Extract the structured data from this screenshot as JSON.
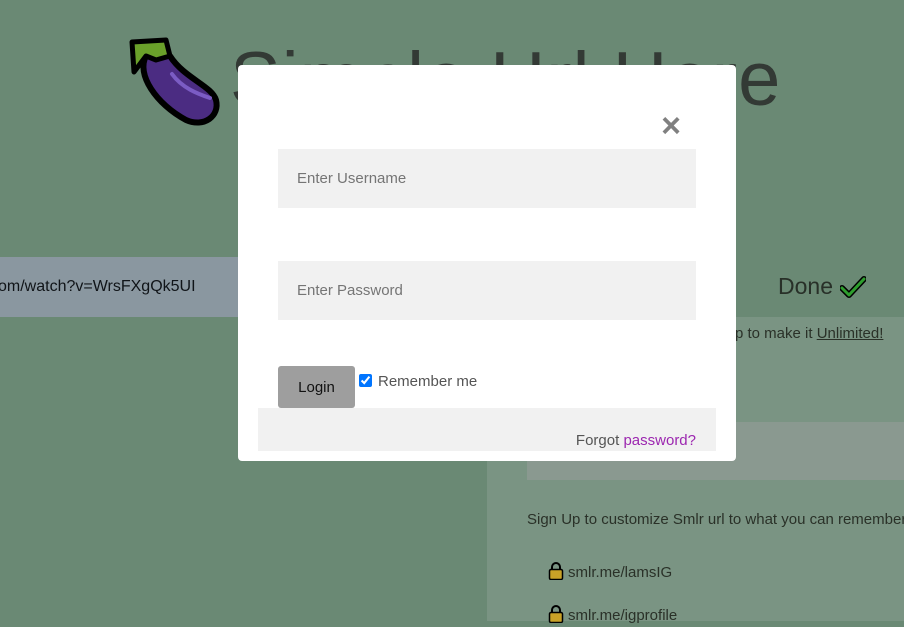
{
  "background": {
    "site_title": "Simple Url Here",
    "url_value": "om/watch?v=WrsFXgQk5UI",
    "done_label": "Done",
    "upgrade_prefix": "p to make it ",
    "upgrade_link": "Unlimited!",
    "signup_text": "Sign Up to customize Smlr url to what you can remember",
    "links": [
      "smlr.me/lamsIG",
      "smlr.me/igprofile"
    ]
  },
  "modal": {
    "close_symbol": "×",
    "username_placeholder": "Enter Username",
    "password_placeholder": "Enter Password",
    "login_label": "Login",
    "remember_label": "Remember me",
    "remember_checked": true,
    "forgot_prefix": "Forgot ",
    "forgot_link": "password?"
  },
  "icons": {
    "logo": "eggplant-icon",
    "done": "check-icon",
    "lock": "lock-icon"
  },
  "colors": {
    "overlay_bg": "#6a8974",
    "link_purple": "#9c27b0",
    "check_green": "#2e9e2e",
    "lock_gold": "#c9a227"
  }
}
